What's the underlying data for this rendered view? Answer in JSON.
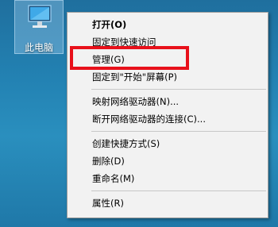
{
  "desktop": {
    "icon_label": "此电脑",
    "icon_name": "computer-icon"
  },
  "context_menu": {
    "items": [
      {
        "label": "打开(O)",
        "bold": true
      },
      {
        "label": "固定到快速访问",
        "bold": false
      },
      {
        "label": "管理(G)",
        "bold": false
      },
      {
        "label": "固定到\"开始\"屏幕(P)",
        "bold": false
      },
      {
        "label": "映射网络驱动器(N)...",
        "bold": false
      },
      {
        "label": "断开网络驱动器的连接(C)...",
        "bold": false
      },
      {
        "label": "创建快捷方式(S)",
        "bold": false
      },
      {
        "label": "删除(D)",
        "bold": false
      },
      {
        "label": "重命名(M)",
        "bold": false
      },
      {
        "label": "属性(R)",
        "bold": false
      }
    ]
  },
  "highlight": {
    "target": "管理(G)",
    "color": "#e8101a"
  }
}
